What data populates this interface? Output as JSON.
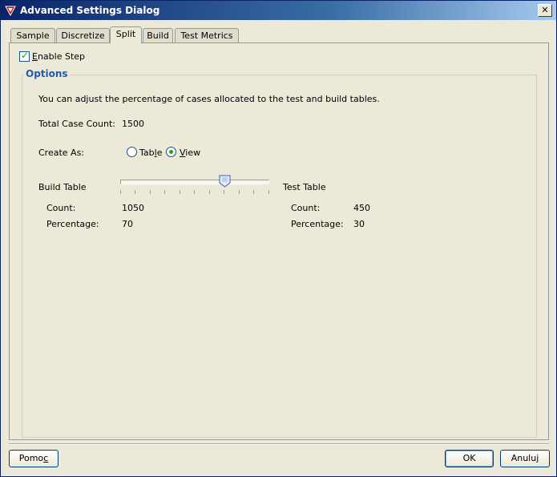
{
  "window": {
    "title": "Advanced Settings Dialog",
    "close_glyph": "✕"
  },
  "tabs": [
    {
      "label": "Sample"
    },
    {
      "label": "Discretize"
    },
    {
      "label": "Split",
      "active": true
    },
    {
      "label": "Build"
    },
    {
      "label": "Test Metrics"
    }
  ],
  "enable_step": {
    "label_first": "E",
    "label_rest": "nable Step",
    "checked": true
  },
  "options": {
    "title": "Options",
    "description": "You can adjust the percentage of cases allocated to the test and build tables.",
    "total_case_label": "Total Case Count:",
    "total_case_value": "1500",
    "create_as_label": "Create As:",
    "radio_table_a": "Tab",
    "radio_table_u": "l",
    "radio_table_b": "e",
    "radio_view_u": "V",
    "radio_view_b": "iew",
    "selected": "View"
  },
  "slider": {
    "value_percent": 70
  },
  "build": {
    "title": "Build Table",
    "count_label": "Count:",
    "count_value": "1050",
    "pct_label": "Percentage:",
    "pct_value": "70"
  },
  "test": {
    "title": "Test Table",
    "count_label": "Count:",
    "count_value": "450",
    "pct_label": "Percentage:",
    "pct_value": "30"
  },
  "buttons": {
    "help_a": "Pomo",
    "help_u": "c",
    "ok": "OK",
    "cancel": "Anuluj"
  },
  "colors": {
    "accent": "#1e5ab4",
    "check": "#21a121",
    "title_bar": "#0a246a"
  }
}
